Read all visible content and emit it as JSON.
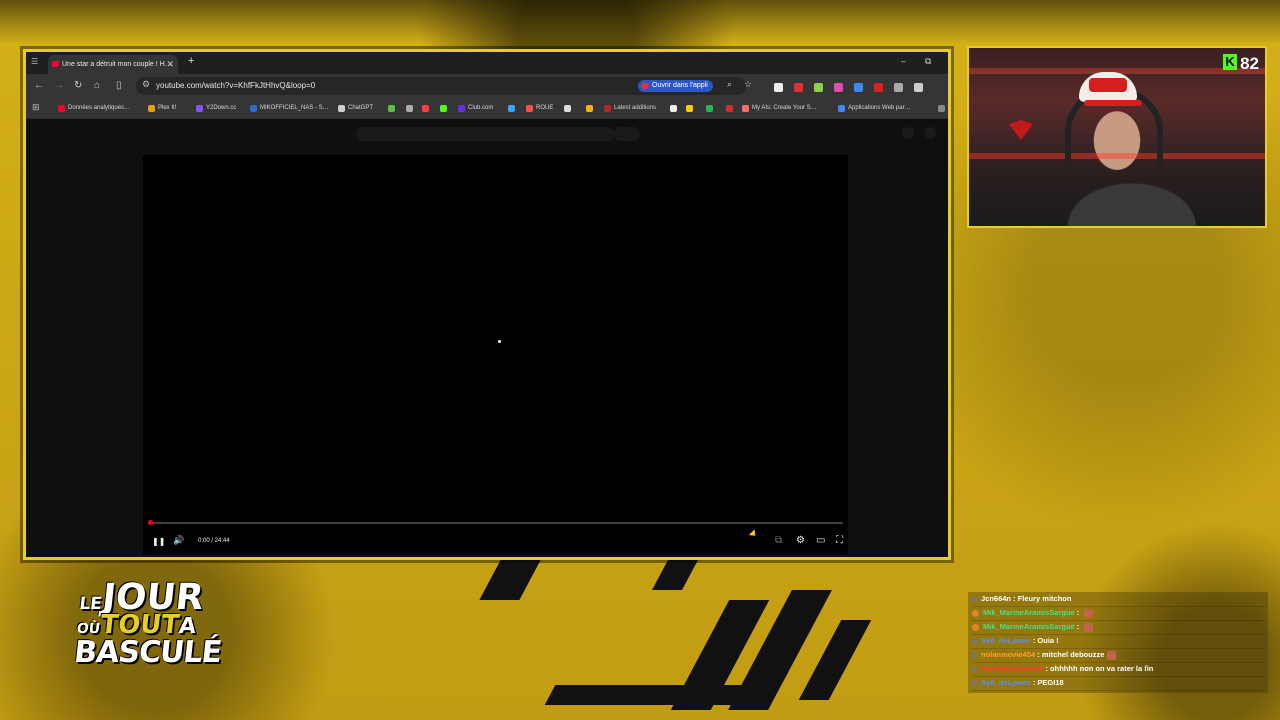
{
  "browser": {
    "tab": {
      "title": "Une star a détruit mon couple ! H…",
      "close": "✕"
    },
    "new_tab": "+",
    "window_controls": {
      "minimize": "–",
      "restore": "⧉"
    },
    "nav": {
      "back": "←",
      "forward": "→",
      "reload": "↻",
      "home": "⌂",
      "side_panel": "▯"
    },
    "url": "youtube.com/watch?v=KhfFkJtHhvQ&loop=0",
    "open_in_app": "Ouvrir dans l'appli",
    "bookmarks": [
      {
        "label": "Données analytiques…",
        "color": "#ff0033"
      },
      {
        "label": "Plex It!",
        "color": "#e5a00d"
      },
      {
        "label": "Y2Down.cc",
        "color": "#8a4fff"
      },
      {
        "label": "MIKOFFICIEL_NAS - S…",
        "color": "#2a6ad1"
      },
      {
        "label": "ChatGPT",
        "color": "#cfcfcf"
      },
      {
        "label": "",
        "color": "#5bbf4a"
      },
      {
        "label": "",
        "color": "#aaaaaa"
      },
      {
        "label": "",
        "color": "#ff3b3b"
      },
      {
        "label": "",
        "color": "#53fc18"
      },
      {
        "label": "Club.com",
        "color": "#6a2ee6"
      },
      {
        "label": "",
        "color": "#3aa0ff"
      },
      {
        "label": "ROUE",
        "color": "#ff4d4d"
      },
      {
        "label": "",
        "color": "#dddddd"
      },
      {
        "label": "",
        "color": "#ffb000"
      },
      {
        "label": "Latest additions",
        "color": "#b02a2a"
      },
      {
        "label": "",
        "color": "#eeeeee"
      },
      {
        "label": "",
        "color": "#ffcc00"
      },
      {
        "label": "",
        "color": "#1db954"
      },
      {
        "label": "",
        "color": "#d32d2d"
      },
      {
        "label": "My AIs: Create Your S…",
        "color": "#ff6b6b"
      },
      {
        "label": "Applications Web par…",
        "color": "#4285f4"
      }
    ],
    "bookmarks_more": "»"
  },
  "player": {
    "time": "0:00 / 24:44",
    "progress_fraction": 0.0,
    "play_icon": "❚❚",
    "volume_icon": "🔊",
    "settings_icon": "⚙",
    "subtitles_icon": "⧉",
    "theater_icon": "▭",
    "fullscreen_icon": "⛶"
  },
  "stream": {
    "viewer_count": "82",
    "platform_icon": "K",
    "logo": {
      "line1_a": "LE",
      "line1_b": "JOUR",
      "line2_a": "OÙ",
      "line2_b": "TOUT",
      "line2_c": "A",
      "line3": "BASCULÉ"
    }
  },
  "chat": [
    {
      "user": "Jcn664n",
      "user_color": "#ffffff",
      "msg": " : Fleury mitchon",
      "badge": false,
      "emote": false
    },
    {
      "user": "Mik_MarineAramisSargue",
      "user_color": "#46e08a",
      "msg": " : ",
      "badge": true,
      "emote": true
    },
    {
      "user": "Mik_MarineAramisSargue",
      "user_color": "#46e08a",
      "msg": " : ",
      "badge": true,
      "emote": true
    },
    {
      "user": "Syd_deLywen",
      "user_color": "#5a8dff",
      "msg": " : Ouia !",
      "badge": false,
      "emote": false
    },
    {
      "user": "nolanmovie454",
      "user_color": "#ff9d2a",
      "msg": " : mitchel debouzze",
      "badge": false,
      "emote": true
    },
    {
      "user": "Wumbletiefumble",
      "user_color": "#ff3b3b",
      "msg": " : ohhhhh non on va rater la fin",
      "badge": false,
      "emote": false
    },
    {
      "user": "Syd_deLywen",
      "user_color": "#5a8dff",
      "msg": " : PEGI18",
      "badge": false,
      "emote": false
    }
  ]
}
